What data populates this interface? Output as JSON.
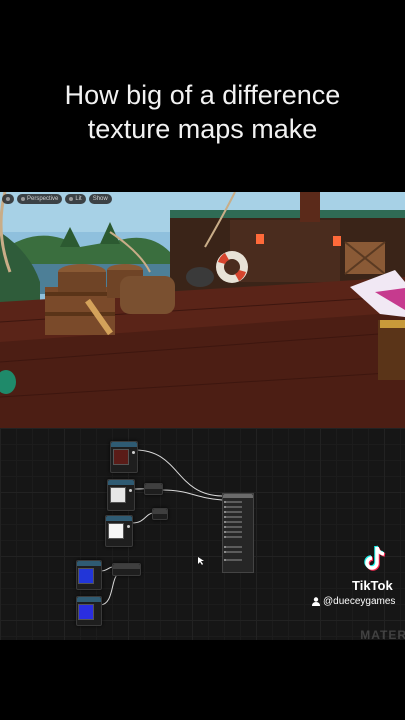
{
  "caption": {
    "line1": "How big of a difference",
    "line2": "texture maps make"
  },
  "viewport": {
    "toolbar": {
      "perspective_label": "Perspective",
      "lit_label": "Lit",
      "show_label": "Show"
    }
  },
  "graph": {
    "watermark": "MATER"
  },
  "tiktok": {
    "brand": "TikTok",
    "handle": "@dueceygames"
  },
  "colors": {
    "deck_wood": "#5a2418",
    "sky": "#8fc0dd",
    "node_header": "#2f5b73",
    "graph_bg": "#161616"
  }
}
